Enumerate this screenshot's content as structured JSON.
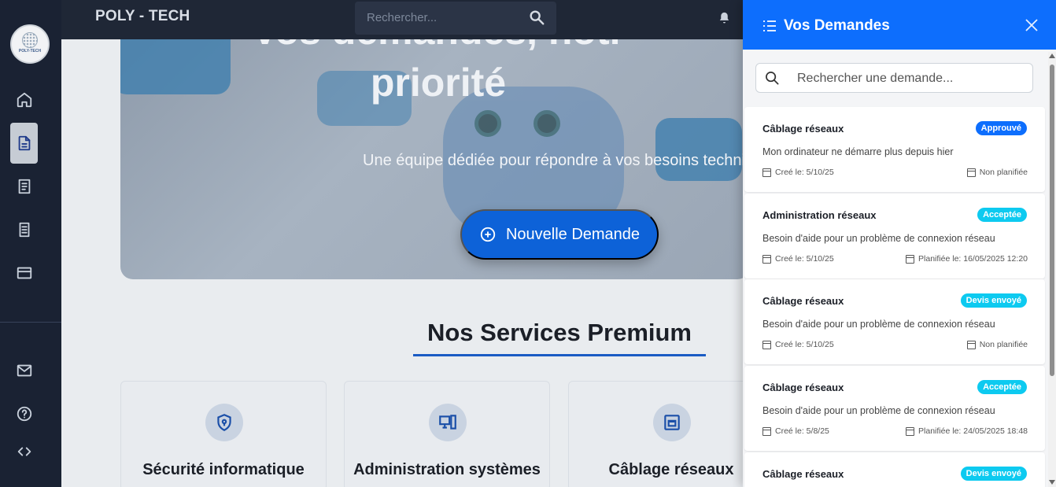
{
  "topbar": {
    "brand": "POLY - TECH",
    "search_placeholder": "Rechercher...",
    "icons": [
      "search-icon",
      "bell-icon"
    ]
  },
  "sidebar": {
    "logo_text": "POLY-TECH",
    "items": [
      {
        "icon": "home-icon"
      },
      {
        "icon": "document-icon",
        "active": true
      },
      {
        "icon": "receipt-icon"
      },
      {
        "icon": "invoice-icon"
      },
      {
        "icon": "credit-card-icon"
      },
      {
        "icon": "mail-icon"
      },
      {
        "icon": "help-icon"
      },
      {
        "icon": "code-icon"
      }
    ]
  },
  "hero": {
    "title_line1": "Vos demandes, notr",
    "title_line2": "priorité",
    "subtitle": "Une équipe dédiée pour répondre à vos besoins techniqu",
    "cta_label": "Nouvelle Demande"
  },
  "services": {
    "title": "Nos Services Premium",
    "cards": [
      {
        "title": "Sécurité informatique",
        "icon": "shield-lock-icon"
      },
      {
        "title": "Administration systèmes",
        "icon": "computer-icon"
      },
      {
        "title": "Câblage réseaux",
        "icon": "ethernet-icon"
      }
    ]
  },
  "panel": {
    "title": "Vos Demandes",
    "search_placeholder": "Rechercher une demande...",
    "requests": [
      {
        "title": "Câblage réseaux",
        "status": "Approuvé",
        "status_color": "#0d6efd",
        "description": "Mon ordinateur ne démarre plus depuis hier",
        "created": "Creé le: 5/10/25",
        "planned": "Non planifiée"
      },
      {
        "title": "Administration réseaux",
        "status": "Acceptée",
        "status_color": "#0dcaf0",
        "description": "Besoin d'aide pour un problème de connexion réseau",
        "created": "Creé le: 5/10/25",
        "planned": "Planifiée le: 16/05/2025 12:20"
      },
      {
        "title": "Câblage réseaux",
        "status": "Devis envoyé",
        "status_color": "#0dcaf0",
        "description": "Besoin d'aide pour un problème de connexion réseau",
        "created": "Creé le: 5/10/25",
        "planned": "Non planifiée"
      },
      {
        "title": "Câblage réseaux",
        "status": "Acceptée",
        "status_color": "#0dcaf0",
        "description": "Besoin d'aide pour un problème de connexion réseau",
        "created": "Creé le: 5/8/25",
        "planned": "Planifiée le: 24/05/2025 18:48"
      },
      {
        "title": "Câblage réseaux",
        "status": "Devis envoyé",
        "status_color": "#0dcaf0",
        "description": "",
        "created": "",
        "planned": ""
      }
    ]
  }
}
